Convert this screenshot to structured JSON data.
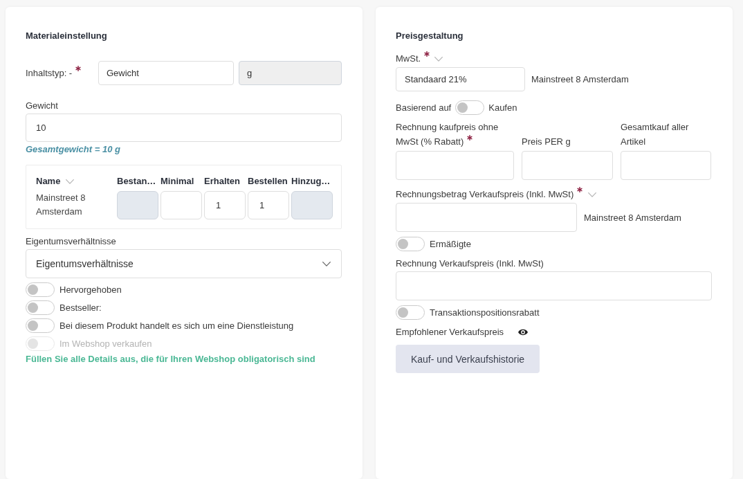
{
  "material": {
    "title": "Materialeinstellung",
    "content_type": {
      "label": "Inhaltstyp: -",
      "required": true,
      "value": "Gewicht",
      "unit": {
        "value": "g",
        "disabled": true
      }
    },
    "weight": {
      "label": "Gewicht",
      "value": "10"
    },
    "total_weight": "Gesamtgewicht = 10 g",
    "stock_table": {
      "columns": [
        {
          "label": "Name",
          "dropdown": true
        },
        {
          "label": "Bestan…",
          "dropdown": false
        },
        {
          "label": "Minimal",
          "dropdown": false
        },
        {
          "label": "Erhalten",
          "dropdown": false
        },
        {
          "label": "Bestellen",
          "dropdown": false
        },
        {
          "label": "Hinzug…",
          "dropdown": false
        }
      ],
      "rows": [
        {
          "cells": [
            {
              "kind": "text",
              "value": "Mainstreet 8 Amsterdam"
            },
            {
              "kind": "input",
              "disabled": true
            },
            {
              "kind": "input",
              "disabled": false
            },
            {
              "kind": "input",
              "value": "1",
              "disabled": false
            },
            {
              "kind": "input",
              "value": "1",
              "disabled": false
            },
            {
              "kind": "input",
              "disabled": true
            }
          ]
        }
      ]
    },
    "ownership": {
      "label": "Eigentumsverhältnisse",
      "value": "Eigentumsverhältnisse"
    },
    "toggles": [
      {
        "label": "Hervorgehoben",
        "on": false,
        "disabled": false
      },
      {
        "label": "Bestseller:",
        "on": false,
        "disabled": false
      },
      {
        "label": "Bei diesem Produkt handelt es sich um eine Dienstleistung",
        "on": false,
        "disabled": false
      },
      {
        "label": "Im Webshop verkaufen",
        "on": false,
        "disabled": true
      }
    ],
    "note": "Füllen Sie alle Details aus, die für Ihren Webshop obligatorisch sind"
  },
  "pricing": {
    "title": "Preisgestaltung",
    "vat": {
      "label": "MwSt.",
      "required": true,
      "dropdown": true,
      "value": "Standaard 21%",
      "location": "Mainstreet 8 Amsterdam"
    },
    "based_on": {
      "label": "Basierend auf",
      "on": false,
      "option": "Kaufen"
    },
    "purchase_fields": [
      {
        "label": "Rechnung kaufpreis ohne MwSt (% Rabatt)",
        "required": true
      },
      {
        "label": "Preis PER g",
        "required": false
      },
      {
        "label": "Gesamtkauf aller Artikel",
        "required": false
      }
    ],
    "sales_amount": {
      "label": "Rechnungsbetrag Verkaufspreis (Inkl. MwSt)",
      "required": true,
      "dropdown": true,
      "location": "Mainstreet 8 Amsterdam"
    },
    "reduced": {
      "label": "Ermäßigte",
      "on": false
    },
    "sales_price": {
      "label": "Rechnung Verkaufspreis (Inkl. MwSt)"
    },
    "item_discount": {
      "label": "Transaktionspositionsrabatt",
      "on": false
    },
    "recommended_price": {
      "label": "Empfohlener Verkaufspreis"
    },
    "history_button": "Kauf- und Verkaufshistorie"
  }
}
